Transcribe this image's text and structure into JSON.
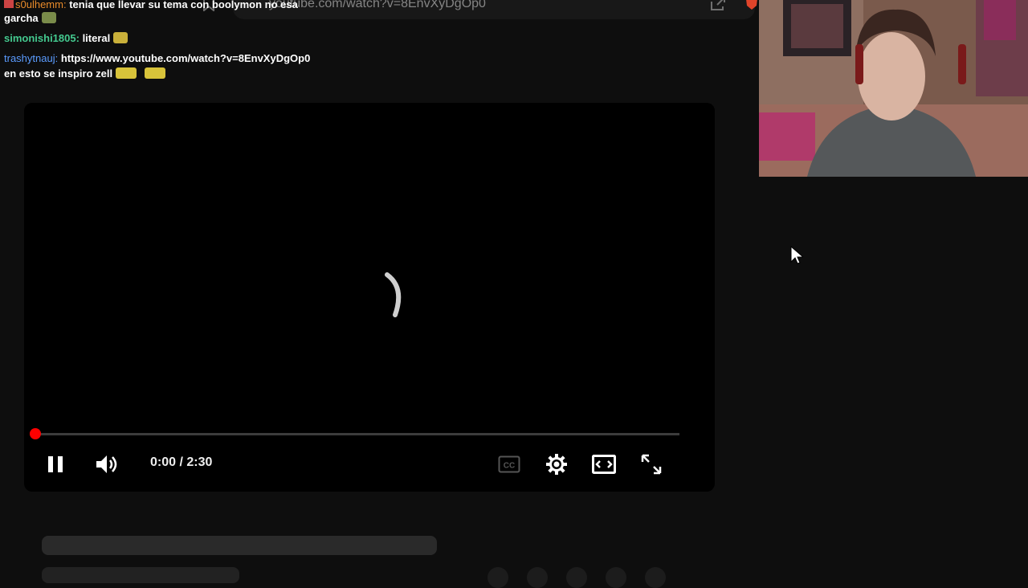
{
  "browser": {
    "url": "youtube.com/watch?v=8EnvXyDgOp0"
  },
  "chat": {
    "messages": [
      {
        "user": "s0ulhemm:",
        "text": "tenia que llevar su tema con boolymon no esa"
      },
      {
        "user": "",
        "text": "garcha"
      },
      {
        "user": "simonishi1805:",
        "text": "literal"
      },
      {
        "user": "trashytnauj:",
        "text": "https://www.youtube.com/watch?v=8EnvXyDgOp0"
      },
      {
        "user": "",
        "text": "en esto se inspiro zell"
      }
    ]
  },
  "player": {
    "current_time": "0:00",
    "separator": " / ",
    "duration": "2:30",
    "progress": 0,
    "state": "loading",
    "controls": [
      "pause-icon",
      "volume-icon",
      "cc-icon",
      "settings-icon",
      "theater-icon",
      "fullscreen-icon"
    ]
  },
  "colors": {
    "accent": "#ff0000",
    "user_orange": "#e98b2a",
    "user_green": "#44c98f",
    "user_blue": "#5b9cff"
  }
}
